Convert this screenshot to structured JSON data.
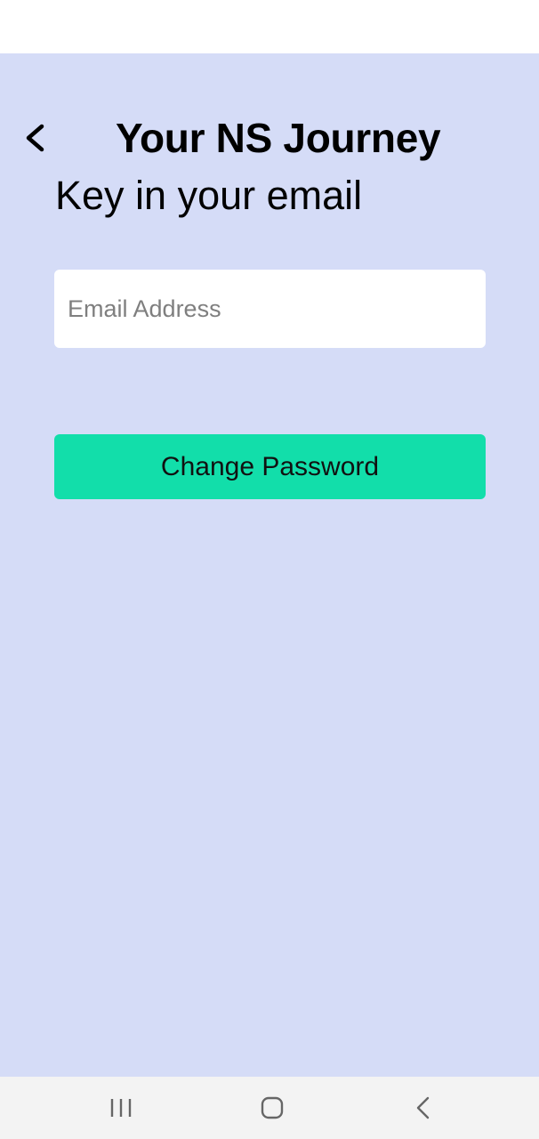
{
  "header": {
    "back_icon": "chevron-left-icon",
    "title": "Your NS Journey"
  },
  "main": {
    "subtitle": "Key in your email",
    "email_field": {
      "placeholder": "Email Address",
      "value": ""
    },
    "change_password_label": "Change Password"
  },
  "colors": {
    "background": "#d5dcf7",
    "button": "#12deaa",
    "input": "#ffffff",
    "nav_bar": "#f3f3f3"
  },
  "nav_bar": {
    "icons": [
      "recents-icon",
      "home-icon",
      "back-icon"
    ]
  }
}
